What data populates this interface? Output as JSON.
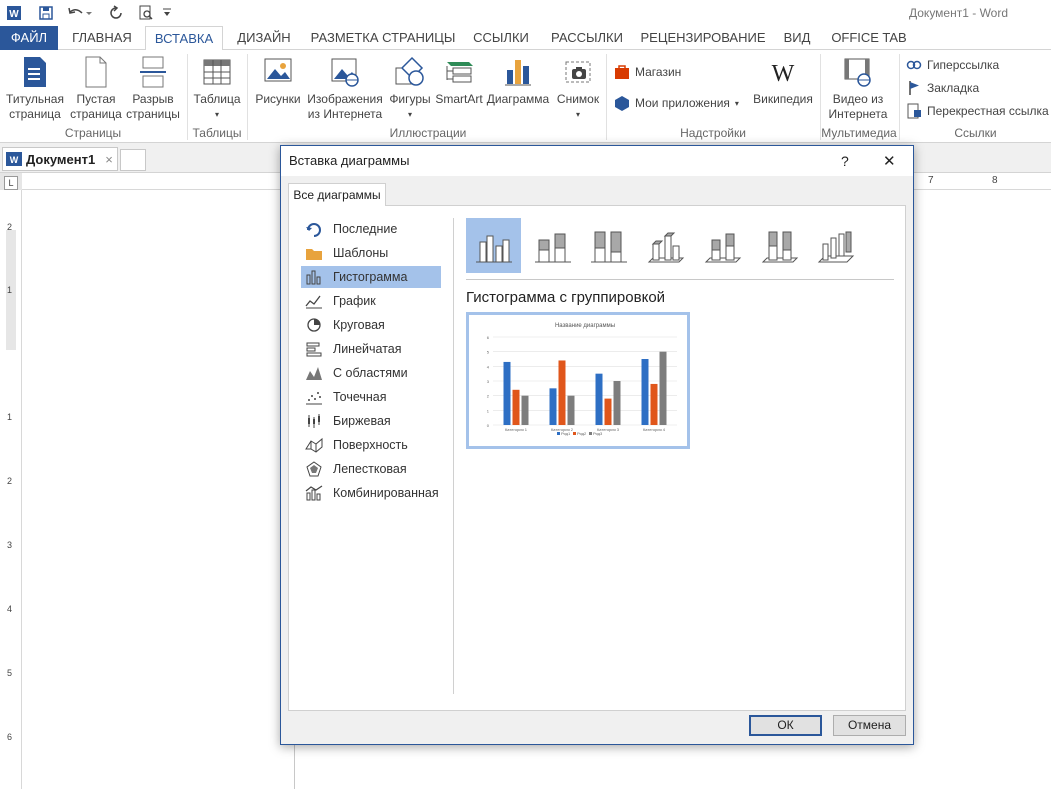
{
  "app": {
    "title": "Документ1 - Word",
    "accent": "#2b579a"
  },
  "quick_access": {
    "icons": [
      "word-logo-icon",
      "save-icon",
      "undo-icon",
      "redo-icon",
      "print-preview-icon",
      "customize-icon"
    ]
  },
  "tabs": [
    {
      "label": "ФАЙЛ"
    },
    {
      "label": "ГЛАВНАЯ"
    },
    {
      "label": "ВСТАВКА"
    },
    {
      "label": "ДИЗАЙН"
    },
    {
      "label": "РАЗМЕТКА СТРАНИЦЫ"
    },
    {
      "label": "ССЫЛКИ"
    },
    {
      "label": "РАССЫЛКИ"
    },
    {
      "label": "РЕЦЕНЗИРОВАНИЕ"
    },
    {
      "label": "ВИД"
    },
    {
      "label": "OFFICE TAB"
    }
  ],
  "ribbon": {
    "pages": {
      "title_page": "Титульная страница",
      "blank_page": "Пустая страница",
      "page_break": "Разрыв страницы",
      "group": "Страницы"
    },
    "tables": {
      "table": "Таблица",
      "group": "Таблицы"
    },
    "illustrations": {
      "pictures": "Рисунки",
      "online": "Изображения из Интернета",
      "shapes": "Фигуры",
      "smartart": "SmartArt",
      "chart": "Диаграмма",
      "screenshot": "Снимок",
      "group": "Иллюстрации"
    },
    "addins": {
      "store": "Магазин",
      "my_apps": "Мои приложения",
      "wikipedia": "Википедия",
      "group": "Надстройки"
    },
    "media": {
      "online_video": "Видео из Интернета",
      "group": "Мультимедиа"
    },
    "links": {
      "hyperlink": "Гиперссылка",
      "bookmark": "Закладка",
      "crossref": "Перекрестная ссылка",
      "group": "Ссылки"
    }
  },
  "doc_tab": {
    "label": "Документ1",
    "close": "×"
  },
  "ruler": {
    "h_labels": [
      "7",
      "8"
    ],
    "v_labels": [
      "2",
      "1",
      "1",
      "2",
      "3",
      "4",
      "5",
      "6"
    ]
  },
  "dialog": {
    "title": "Вставка диаграммы",
    "help": "?",
    "close": "✕",
    "tab": "Все диаграммы",
    "categories": [
      {
        "label": "Последние",
        "icon": "recent-icon"
      },
      {
        "label": "Шаблоны",
        "icon": "folder-icon"
      },
      {
        "label": "Гистограмма",
        "icon": "column-chart-icon",
        "selected": true
      },
      {
        "label": "График",
        "icon": "line-chart-icon"
      },
      {
        "label": "Круговая",
        "icon": "pie-chart-icon"
      },
      {
        "label": "Линейчатая",
        "icon": "bar-chart-icon"
      },
      {
        "label": "С областями",
        "icon": "area-chart-icon"
      },
      {
        "label": "Точечная",
        "icon": "scatter-chart-icon"
      },
      {
        "label": "Биржевая",
        "icon": "stock-chart-icon"
      },
      {
        "label": "Поверхность",
        "icon": "surface-chart-icon"
      },
      {
        "label": "Лепестковая",
        "icon": "radar-chart-icon"
      },
      {
        "label": "Комбинированная",
        "icon": "combo-chart-icon"
      }
    ],
    "subtype_title": "Гистограмма с группировкой",
    "preview": {
      "title": "Название диаграммы",
      "yticks": [
        "0",
        "1",
        "2",
        "3",
        "4",
        "5",
        "6"
      ],
      "categories": [
        "Категория 1",
        "Категория 2",
        "Категория 3",
        "Категория 4"
      ],
      "series": [
        {
          "name": "Ряд1",
          "color": "#2e6fc4",
          "values": [
            4.3,
            2.5,
            3.5,
            4.5
          ]
        },
        {
          "name": "Ряд2",
          "color": "#e0561b",
          "values": [
            2.4,
            4.4,
            1.8,
            2.8
          ]
        },
        {
          "name": "Ряд3",
          "color": "#7d7d7d",
          "values": [
            2.0,
            2.0,
            3.0,
            5.0
          ]
        }
      ]
    },
    "ok": "ОК",
    "cancel": "Отмена"
  }
}
